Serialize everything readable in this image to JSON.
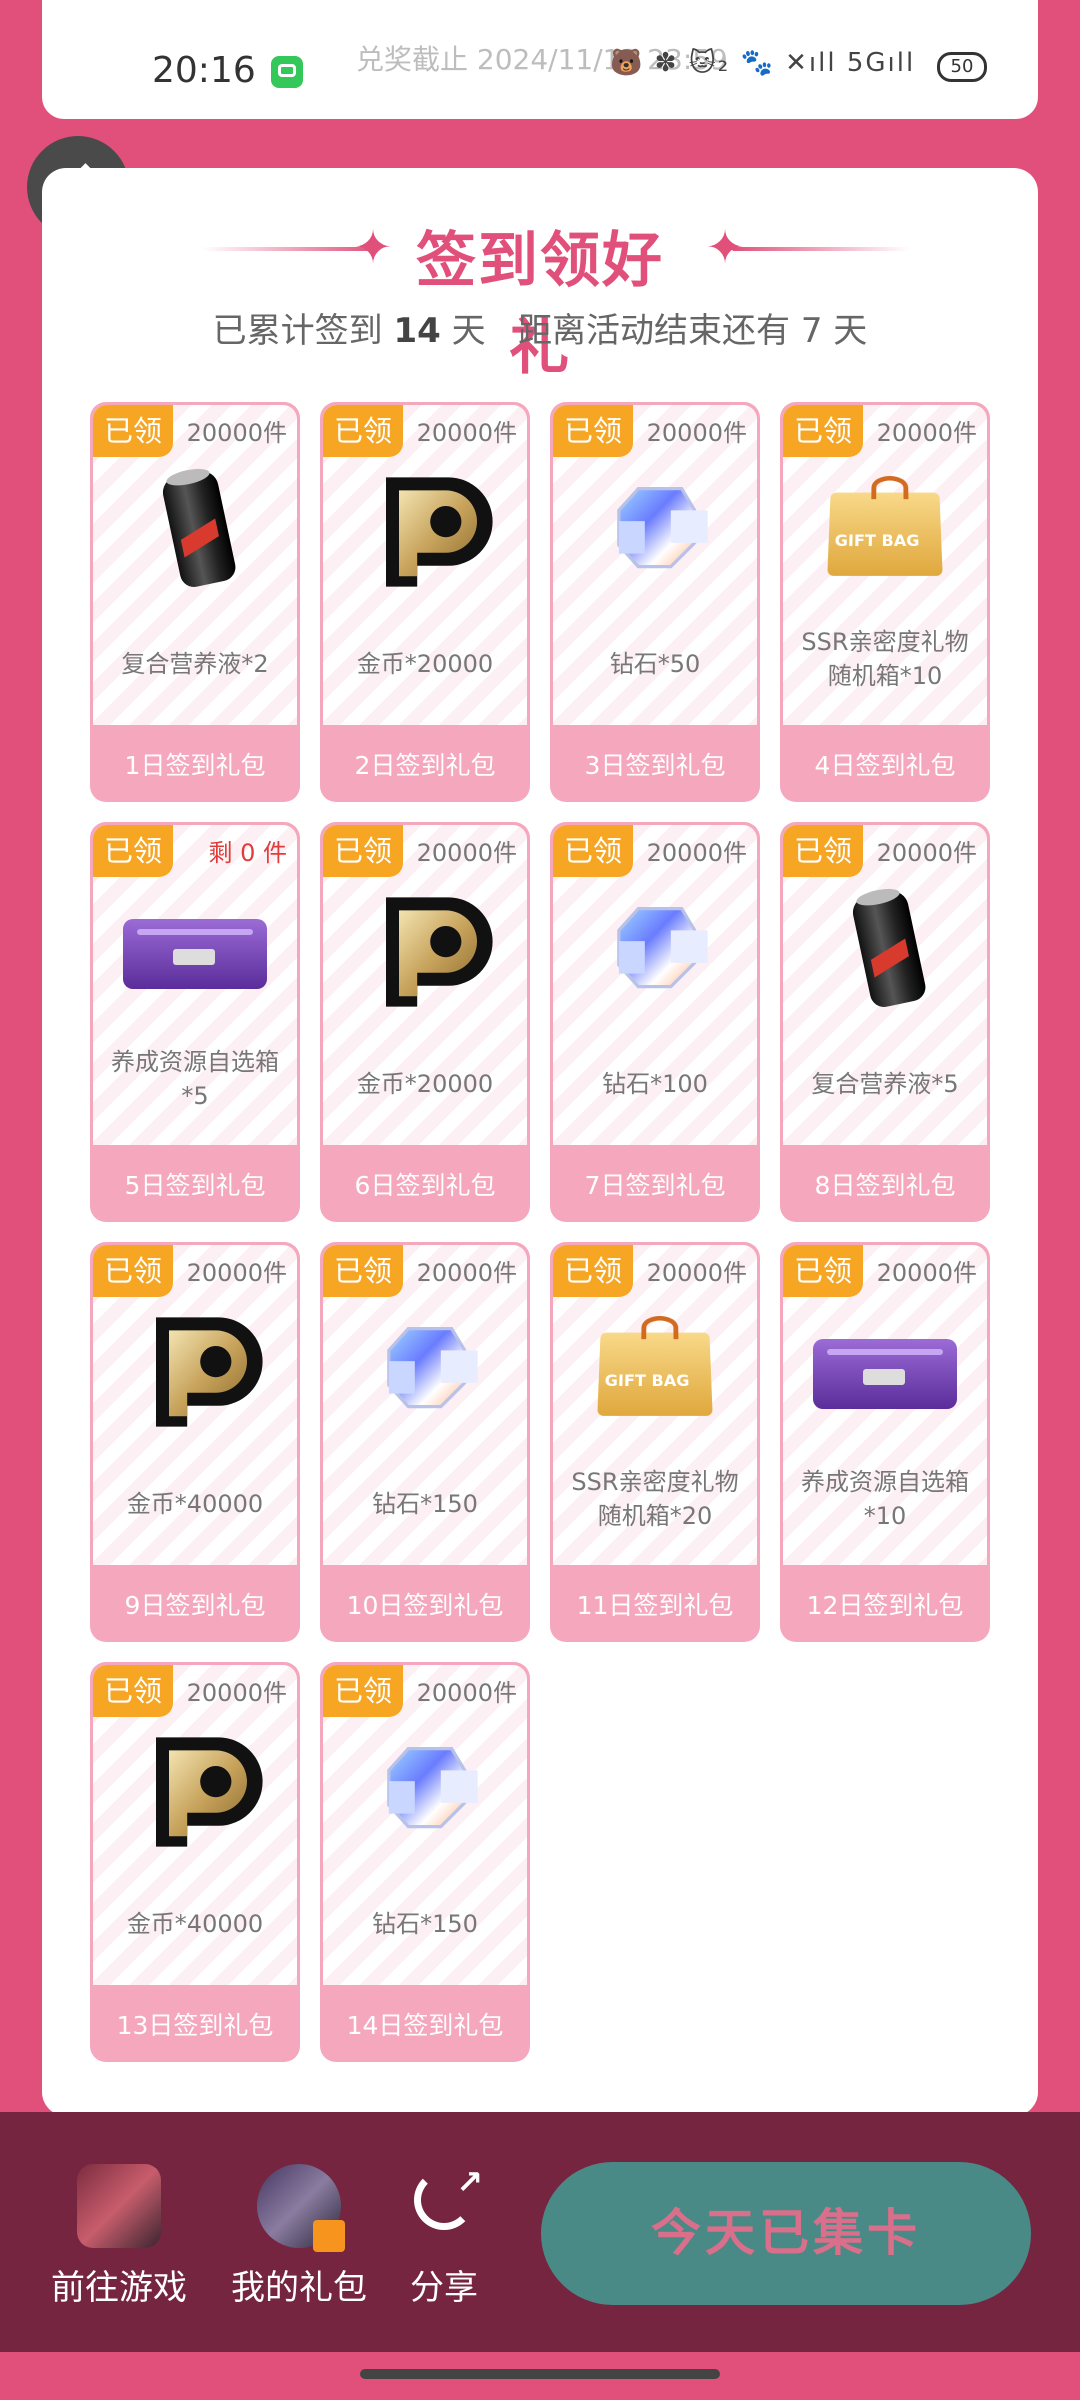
{
  "status_bar": {
    "time": "20:16",
    "deadline": "兑奖截止 2024/11/13 23:59",
    "icons_text": "🐻 ✽ 🐱₂ 🐾 ✕ıll 5Gıll",
    "battery": "50"
  },
  "header": {
    "title": "签到领好礼",
    "subtitle_prefix": "已累计签到",
    "days_signed": "14",
    "days_unit": "天",
    "remaining_text": "距离活动结束还有 7 天"
  },
  "gifts": [
    {
      "badge": "已领",
      "stock": "20000件",
      "name": "复合营养液*2",
      "name2": "",
      "day": "1日签到礼包",
      "icon": "can-icon"
    },
    {
      "badge": "已领",
      "stock": "20000件",
      "name": "金币*20000",
      "name2": "",
      "day": "2日签到礼包",
      "icon": "coin-icon"
    },
    {
      "badge": "已领",
      "stock": "20000件",
      "name": "钻石*50",
      "name2": "",
      "day": "3日签到礼包",
      "icon": "diamond-icon"
    },
    {
      "badge": "已领",
      "stock": "20000件",
      "name": "SSR亲密度礼物",
      "name2": "随机箱*10",
      "day": "4日签到礼包",
      "icon": "gift-bag-icon"
    },
    {
      "badge": "已领",
      "stock": "剩 0 件",
      "name": "养成资源自选箱",
      "name2": "*5",
      "day": "5日签到礼包",
      "icon": "crate-icon"
    },
    {
      "badge": "已领",
      "stock": "20000件",
      "name": "金币*20000",
      "name2": "",
      "day": "6日签到礼包",
      "icon": "coin-icon"
    },
    {
      "badge": "已领",
      "stock": "20000件",
      "name": "钻石*100",
      "name2": "",
      "day": "7日签到礼包",
      "icon": "diamond-icon"
    },
    {
      "badge": "已领",
      "stock": "20000件",
      "name": "复合营养液*5",
      "name2": "",
      "day": "8日签到礼包",
      "icon": "can-icon"
    },
    {
      "badge": "已领",
      "stock": "20000件",
      "name": "金币*40000",
      "name2": "",
      "day": "9日签到礼包",
      "icon": "coin-icon"
    },
    {
      "badge": "已领",
      "stock": "20000件",
      "name": "钻石*150",
      "name2": "",
      "day": "10日签到礼包",
      "icon": "diamond-icon"
    },
    {
      "badge": "已领",
      "stock": "20000件",
      "name": "SSR亲密度礼物",
      "name2": "随机箱*20",
      "day": "11日签到礼包",
      "icon": "gift-bag-icon"
    },
    {
      "badge": "已领",
      "stock": "20000件",
      "name": "养成资源自选箱",
      "name2": "*10",
      "day": "12日签到礼包",
      "icon": "crate-icon"
    },
    {
      "badge": "已领",
      "stock": "20000件",
      "name": "金币*40000",
      "name2": "",
      "day": "13日签到礼包",
      "icon": "coin-icon"
    },
    {
      "badge": "已领",
      "stock": "20000件",
      "name": "钻石*150",
      "name2": "",
      "day": "14日签到礼包",
      "icon": "diamond-icon"
    }
  ],
  "bottom_nav": {
    "go_game": "前往游戏",
    "my_gifts": "我的礼包",
    "share": "分享",
    "claimed_button": "今天已集卡"
  },
  "colors": {
    "accent": "#e0507a",
    "badge": "#f6a623",
    "day_bar": "#f5a7bd",
    "bottom_bar": "#75253f",
    "claimed_button": "#4a8a86"
  }
}
